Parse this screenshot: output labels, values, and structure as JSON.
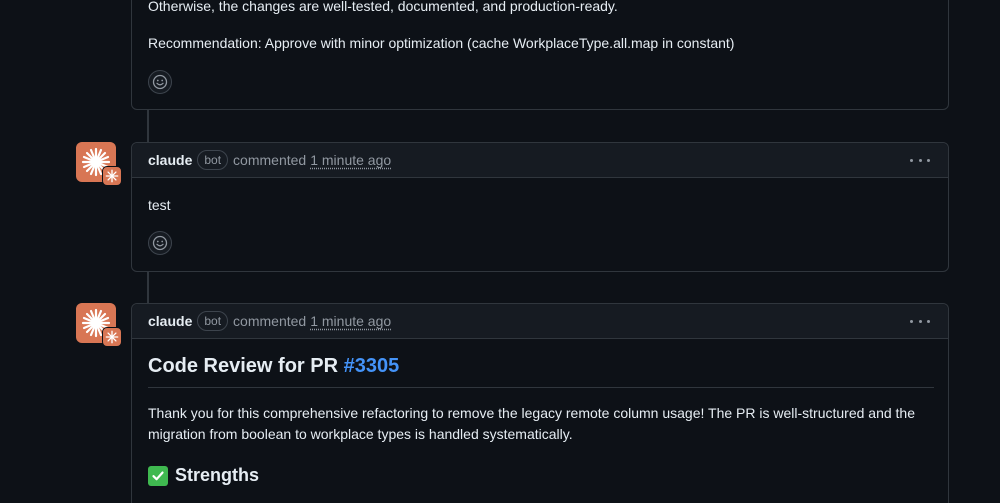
{
  "comment_prev": {
    "line1": "Otherwise, the changes are well-tested, documented, and production-ready.",
    "line2": "Recommendation: Approve with minor optimization (cache WorkplaceType.all.map in constant)"
  },
  "comment_test": {
    "author": "claude",
    "badge": "bot",
    "action": "commented",
    "timestamp": "1 minute ago",
    "body": "test"
  },
  "comment_review": {
    "author": "claude",
    "badge": "bot",
    "action": "commented",
    "timestamp": "1 minute ago",
    "heading_prefix": "Code Review for PR",
    "pr_link": "#3305",
    "paragraph": "Thank you for this comprehensive refactoring to remove the legacy remote column usage! The PR is well-structured and the migration from boolean to workplace types is handled systematically.",
    "strengths_heading": "Strengths"
  },
  "icons": {
    "avatar": "claude-starburst-icon",
    "reaction": "smiley-icon",
    "menu": "kebab-menu-icon",
    "strengths": "check-mark-button-icon"
  },
  "colors": {
    "background": "#0d1117",
    "border": "#30363d",
    "header": "#161b22",
    "link": "#4493f8",
    "avatar": "#d87654",
    "check": "#3fb950"
  }
}
